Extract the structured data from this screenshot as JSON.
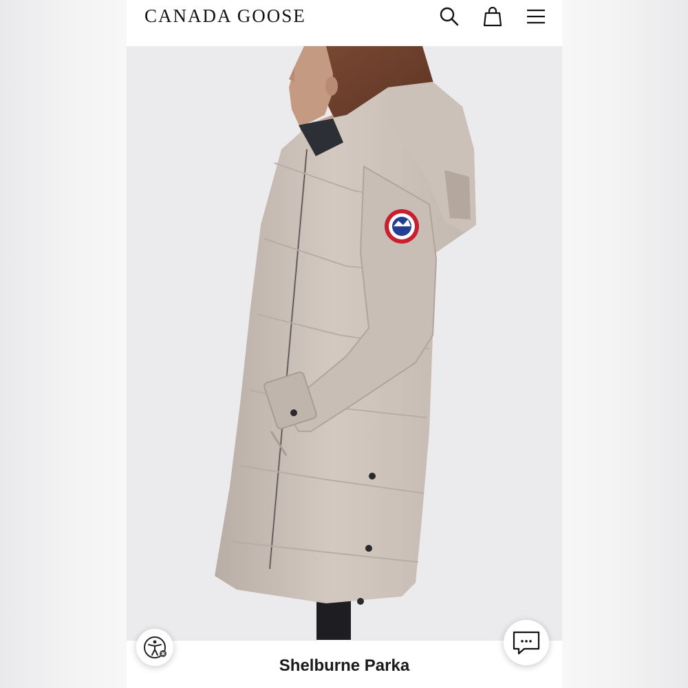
{
  "header": {
    "brand": "CANADA GOOSE",
    "icons": [
      "search-icon",
      "shopping-bag-icon",
      "hamburger-menu-icon"
    ]
  },
  "product": {
    "name": "Shelburne Parka",
    "image_subject": "Woman wearing a long hooded beige down parka, side profile view",
    "badge_text": "CANADA GOOSE ARCTIC PROGRAM"
  },
  "floating_buttons": {
    "accessibility_icon": "accessibility-icon",
    "chat_icon": "chat-bubble-icon"
  },
  "colors": {
    "parka": "#cfc5bc",
    "badge_red": "#c8202f",
    "badge_blue": "#233f8f",
    "background": "#ebebed"
  }
}
